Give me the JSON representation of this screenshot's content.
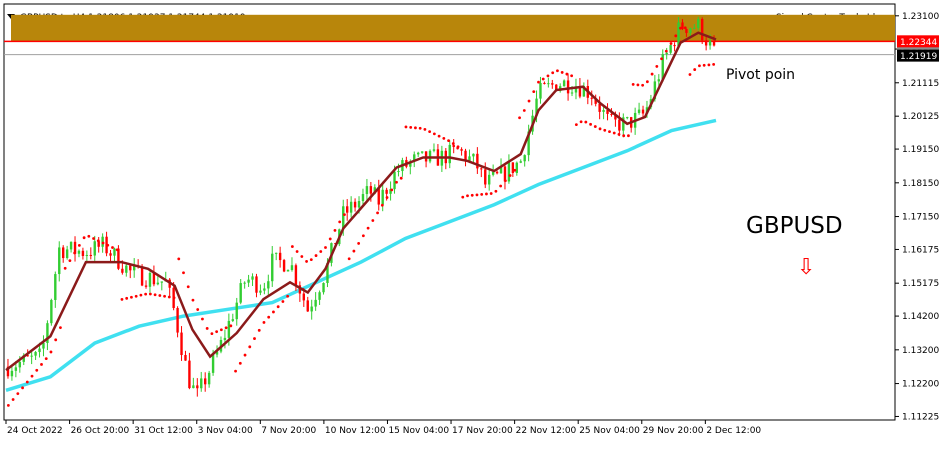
{
  "header": {
    "symbol_info": "GBPUSD,tp,H4  1.21806 1.21937 1.21744 1.21919",
    "indicator_name": "Signal Centre Trade Ideas"
  },
  "annotations": {
    "pivot_label": "Pivot poin",
    "pair_label": "GBPUSD",
    "arrow_label": "⇩"
  },
  "colors": {
    "zone": "#b8860b",
    "resistance_line": "#ff0000",
    "pivot_line": "#a0a0a0",
    "bull_candle": "#32cd32",
    "bear_candle": "#ff0000",
    "fast_ma": "#8b1a1a",
    "slow_ma": "#40e0f0",
    "sar_dots": "#ff0000",
    "price_tag_red": "#ff0000",
    "price_tag_black": "#000000"
  },
  "price_tags": {
    "resistance": "1.22344",
    "current": "1.21919",
    "pivot_partial": "1.2191"
  },
  "chart_data": {
    "type": "candlestick",
    "y_ticks": [
      "1.23100",
      "1.22115",
      "1.21115",
      "1.20125",
      "1.19150",
      "1.18150",
      "1.17150",
      "1.16175",
      "1.15175",
      "1.14200",
      "1.13200",
      "1.12200",
      "1.11225"
    ],
    "y_tick_values": [
      1.231,
      1.22115,
      1.21115,
      1.20125,
      1.1915,
      1.1815,
      1.1715,
      1.16175,
      1.15175,
      1.142,
      1.132,
      1.122,
      1.11225
    ],
    "ylim": [
      1.1112,
      1.2345
    ],
    "x_ticks": [
      "24 Oct 2022",
      "26 Oct 20:00",
      "31 Oct 12:00",
      "3 Nov 04:00",
      "7 Nov 20:00",
      "10 Nov 12:00",
      "15 Nov 04:00",
      "17 Nov 20:00",
      "22 Nov 12:00",
      "25 Nov 04:00",
      "29 Nov 20:00",
      "2 Dec 12:00"
    ],
    "zone": {
      "low": 1.2234,
      "high": 1.2313
    },
    "resistance_level": 1.22344,
    "pivot_level": 1.2195,
    "close_path": [
      [
        0,
        1.127
      ],
      [
        0.04,
        1.13
      ],
      [
        0.06,
        1.162
      ],
      [
        0.09,
        1.161
      ],
      [
        0.11,
        1.163
      ],
      [
        0.14,
        1.155
      ],
      [
        0.18,
        1.152
      ],
      [
        0.19,
        1.143
      ],
      [
        0.205,
        1.124
      ],
      [
        0.215,
        1.118
      ],
      [
        0.24,
        1.132
      ],
      [
        0.27,
        1.153
      ],
      [
        0.29,
        1.151
      ],
      [
        0.3,
        1.158
      ],
      [
        0.32,
        1.158
      ],
      [
        0.34,
        1.144
      ],
      [
        0.36,
        1.155
      ],
      [
        0.38,
        1.172
      ],
      [
        0.41,
        1.179
      ],
      [
        0.42,
        1.176
      ],
      [
        0.44,
        1.185
      ],
      [
        0.46,
        1.188
      ],
      [
        0.49,
        1.189
      ],
      [
        0.51,
        1.191
      ],
      [
        0.53,
        1.187
      ],
      [
        0.54,
        1.181
      ],
      [
        0.56,
        1.184
      ],
      [
        0.58,
        1.188
      ],
      [
        0.6,
        1.208
      ],
      [
        0.62,
        1.211
      ],
      [
        0.64,
        1.211
      ],
      [
        0.66,
        1.208
      ],
      [
        0.68,
        1.199
      ],
      [
        0.7,
        1.199
      ],
      [
        0.72,
        1.202
      ],
      [
        0.74,
        1.217
      ],
      [
        0.76,
        1.228
      ],
      [
        0.78,
        1.228
      ],
      [
        0.8,
        1.219
      ]
    ],
    "fast_ma": [
      [
        0,
        1.126
      ],
      [
        0.05,
        1.136
      ],
      [
        0.09,
        1.158
      ],
      [
        0.13,
        1.158
      ],
      [
        0.16,
        1.156
      ],
      [
        0.19,
        1.151
      ],
      [
        0.21,
        1.138
      ],
      [
        0.23,
        1.13
      ],
      [
        0.26,
        1.137
      ],
      [
        0.29,
        1.147
      ],
      [
        0.32,
        1.152
      ],
      [
        0.34,
        1.149
      ],
      [
        0.36,
        1.156
      ],
      [
        0.38,
        1.168
      ],
      [
        0.41,
        1.177
      ],
      [
        0.44,
        1.186
      ],
      [
        0.47,
        1.189
      ],
      [
        0.5,
        1.189
      ],
      [
        0.52,
        1.188
      ],
      [
        0.55,
        1.185
      ],
      [
        0.58,
        1.19
      ],
      [
        0.6,
        1.203
      ],
      [
        0.62,
        1.209
      ],
      [
        0.65,
        1.21
      ],
      [
        0.67,
        1.205
      ],
      [
        0.7,
        1.199
      ],
      [
        0.72,
        1.201
      ],
      [
        0.74,
        1.212
      ],
      [
        0.76,
        1.223
      ],
      [
        0.78,
        1.226
      ],
      [
        0.8,
        1.224
      ]
    ],
    "slow_ma": [
      [
        0,
        1.12
      ],
      [
        0.05,
        1.124
      ],
      [
        0.1,
        1.134
      ],
      [
        0.15,
        1.139
      ],
      [
        0.2,
        1.142
      ],
      [
        0.25,
        1.144
      ],
      [
        0.3,
        1.146
      ],
      [
        0.35,
        1.152
      ],
      [
        0.4,
        1.158
      ],
      [
        0.45,
        1.165
      ],
      [
        0.5,
        1.17
      ],
      [
        0.55,
        1.175
      ],
      [
        0.6,
        1.181
      ],
      [
        0.65,
        1.186
      ],
      [
        0.7,
        1.191
      ],
      [
        0.75,
        1.197
      ],
      [
        0.8,
        1.2
      ]
    ]
  }
}
